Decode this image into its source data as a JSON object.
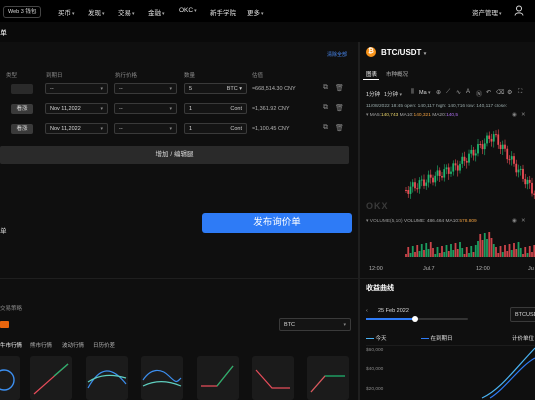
{
  "topbar": {
    "web3_label": "Web 3 钱包",
    "nav": [
      "买币",
      "发现",
      "交易",
      "金融",
      "OKC",
      "新手学院",
      "更多"
    ],
    "asset_mgmt": "资产管理"
  },
  "subbar": {
    "title_fragment": "单"
  },
  "legs": {
    "headers": [
      "类型",
      "到期日",
      "执行价格",
      "数量",
      "估值"
    ],
    "clear_all": "清除全部",
    "rows": [
      {
        "action": "",
        "expiry": "--",
        "strike": "--",
        "qty": "5",
        "unit": "BTC",
        "value": "≈668,514.30 CNY"
      },
      {
        "action": "看涨",
        "expiry": "Nov 11,2022",
        "strike": "--",
        "qty": "1",
        "unit": "Cont",
        "value": "≈1,361.92 CNY"
      },
      {
        "action": "看涨",
        "expiry": "Nov 11,2022",
        "strike": "--",
        "qty": "1",
        "unit": "Cont",
        "value": "≈1,100.45 CNY"
      }
    ],
    "add_edit": "增加 / 编辑腿",
    "left_fragment": "单",
    "publish": "发布询价单"
  },
  "bottom_left": {
    "title_fragment": "交易策略",
    "badge": "",
    "select_value": "BTC",
    "tabs": [
      "牛市行情",
      "熊市行情",
      "波动行情",
      "日历价差"
    ],
    "first_tab_fragment": "牛市行情"
  },
  "market": {
    "pair": "BTC/USDT",
    "tabs": [
      "图表",
      "市种概况"
    ],
    "interval": "1分钟",
    "timeframe": "1分钟",
    "indicator": "Ma",
    "ohlc": "11/08/2022 18:45  open: 140,117  high: 140,716  low: 140,117  close:",
    "ma_label": "MA5:",
    "ma5": "140,743",
    "ma10_label": "MA10:",
    "ma10": "140,321",
    "ma20_label": "MA20:",
    "ma20": "140,5",
    "volume_label": "VOLUME(5,10)",
    "volume": "VOLUME: 486.464",
    "ma10_vol_label": "MA10:",
    "ma10_vol": "578.809",
    "watermark": "OKX",
    "x_ticks": [
      "12:00",
      "Jul.7",
      "12:00",
      "Ju"
    ]
  },
  "yield": {
    "title": "收益曲线",
    "date": "25 Feb 2022",
    "select_value": "BTCUSD",
    "legend_today": "今天",
    "legend_expiry": "在到期日",
    "legend_price": "计价单位",
    "y_ticks": [
      "$60,000",
      "$40,000",
      "$20,000"
    ]
  },
  "colors": {
    "up": "#1fb66f",
    "down": "#ec4d55",
    "accent": "#2e7bf6",
    "orange": "#e8650d"
  }
}
